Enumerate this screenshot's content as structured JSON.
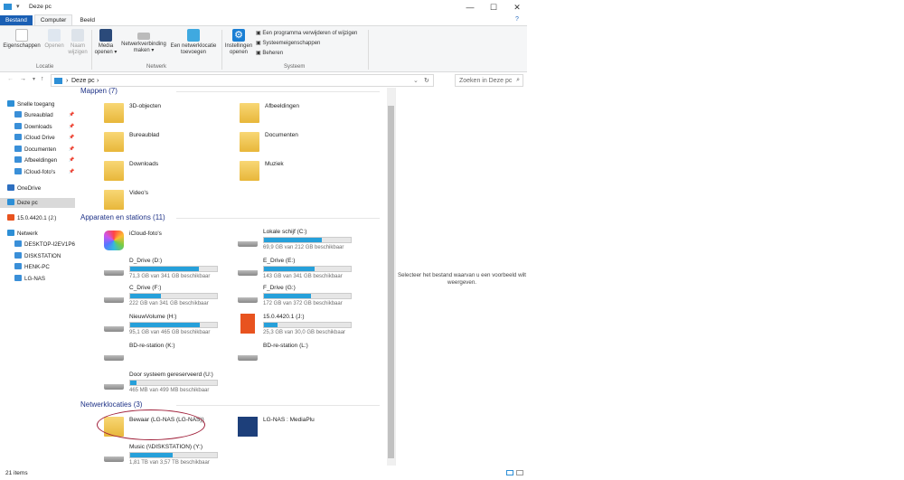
{
  "window": {
    "title": "Deze pc",
    "controls": [
      "—",
      "☐",
      "✕"
    ]
  },
  "ribbon_tabs": [
    "Bestand",
    "Computer",
    "Beeld"
  ],
  "ribbon": {
    "locatie": {
      "label": "Locatie",
      "buttons": [
        "Eigenschappen",
        "Openen",
        "Naam wijzigen"
      ]
    },
    "netwerk": {
      "label": "Netwerk",
      "buttons": [
        "Media openen ▾",
        "Netwerkverbinding maken ▾",
        "Een netwerklocatie toevoegen"
      ]
    },
    "systeem": {
      "label": "Systeem",
      "big": "Instellingen openen",
      "small": [
        "Een programma verwijderen of wijzigen",
        "Systeemeigenschappen",
        "Beheren"
      ]
    }
  },
  "address": {
    "path": "Deze pc",
    "search_placeholder": "Zoeken in Deze pc"
  },
  "nav": {
    "quick": "Snelle toegang",
    "quick_items": [
      "Bureaublad",
      "Downloads",
      "iCloud Drive",
      "Documenten",
      "Afbeeldingen",
      "iCloud-foto's"
    ],
    "onedrive": "OneDrive",
    "thispc": "Deze pc",
    "office": "15.0.4420.1 (J:)",
    "network": "Netwerk",
    "network_items": [
      "DESKTOP-I2EV1P6",
      "DISKSTATION",
      "HENK-PC",
      "LG-NAS"
    ]
  },
  "folders": {
    "header": "Mappen (7)",
    "items": [
      "3D-objecten",
      "Afbeeldingen",
      "Bureaublad",
      "Documenten",
      "Downloads",
      "Muziek",
      "Video's"
    ]
  },
  "devices": {
    "header": "Apparaten en stations (11)",
    "items": [
      {
        "name": "iCloud-foto's"
      },
      {
        "name": "Lokale schijf (C:)",
        "size": "69,9 GB van 212 GB beschikbaar",
        "used": 0.67
      },
      {
        "name": "D_Drive (D:)",
        "size": "71,3 GB van 341 GB beschikbaar",
        "used": 0.79
      },
      {
        "name": "E_Drive (E:)",
        "size": "143 GB van 341 GB beschikbaar",
        "used": 0.58
      },
      {
        "name": "C_Drive (F:)",
        "size": "222 GB van 341 GB beschikbaar",
        "used": 0.35
      },
      {
        "name": "F_Drive (G:)",
        "size": "172 GB van 372 GB beschikbaar",
        "used": 0.54
      },
      {
        "name": "NieuwVolume (H:)",
        "size": "95,1 GB van 465 GB beschikbaar",
        "used": 0.8
      },
      {
        "name": "15.0.4420.1 (J:)",
        "size": "25,3 GB van 30,0 GB beschikbaar",
        "used": 0.16
      },
      {
        "name": "BD-re-station (K:)"
      },
      {
        "name": "BD-re-station (L:)"
      },
      {
        "name": "Door systeem gereserveerd (U:)",
        "size": "465 MB van 499 MB beschikbaar",
        "used": 0.07
      }
    ]
  },
  "netloc": {
    "header": "Netwerklocaties (3)",
    "items": [
      {
        "name": "Bewaar (LG-NAS (LG-NAS))"
      },
      {
        "name": "LG-NAS : MediaPlu"
      },
      {
        "name": "Music (\\\\DISKSTATION) (Y:)",
        "size": "1,81 TB van 3,57 TB beschikbaar",
        "used": 0.49
      }
    ]
  },
  "preview_text": "Selecteer het bestand waarvan u een voorbeeld wilt weergeven.",
  "status": "21 items"
}
